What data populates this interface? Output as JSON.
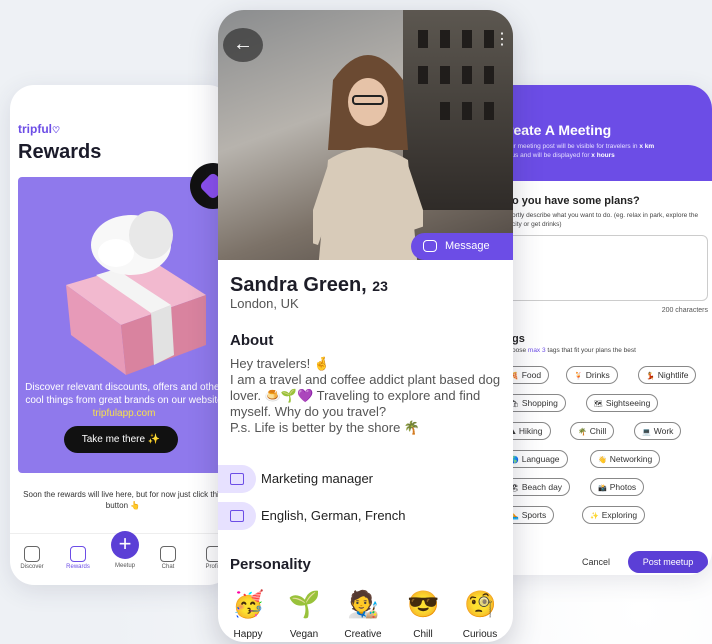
{
  "colors": {
    "accent": "#6c4de6",
    "dark": "#111111"
  },
  "rewards": {
    "brand": "tripful",
    "title": "Rewards",
    "description": "Discover relevant discounts, offers and other cool things  from great brands on our website ",
    "link": "tripfulapp.com",
    "cta": "Take me there ✨",
    "note": "Soon the rewards will live here, but for now just click this button 👆",
    "tabs": [
      {
        "label": "Discover",
        "icon": "compass-icon",
        "active": false
      },
      {
        "label": "Rewards",
        "icon": "gift-icon",
        "active": true
      },
      {
        "label": "Meetup",
        "icon": "plus-icon",
        "active": false
      },
      {
        "label": "Chat",
        "icon": "chat-icon",
        "active": false
      },
      {
        "label": "Profile",
        "icon": "profile-icon",
        "active": false
      }
    ]
  },
  "profile": {
    "message": "Message",
    "name": "Sandra Green,",
    "age": "23",
    "location": "London, UK",
    "about_heading": "About",
    "about_line1": "Hey travelers! 🤞",
    "about_line2": "I am a travel and coffee addict plant based dog lover. 🍮🌱💜 Traveling to explore and find myself. Why do you travel?",
    "about_line3": "P.s. Life is better by the shore 🌴",
    "job": "Marketing manager",
    "languages": "English, German, French",
    "personality_heading": "Personality",
    "personality": [
      {
        "label": "Happy",
        "emoji": "🥳"
      },
      {
        "label": "Vegan",
        "emoji": "🌱"
      },
      {
        "label": "Creative",
        "emoji": "🧑‍🎨"
      },
      {
        "label": "Chill",
        "emoji": "😎"
      },
      {
        "label": "Curious",
        "emoji": "🧐"
      }
    ]
  },
  "meeting": {
    "title": "reate A Meeting",
    "sub_a": "ur meeting post will be visible for travelers in ",
    "sub_km": "x km",
    "sub_b": "ius and will be displayed for ",
    "sub_hours": "x hours",
    "question": "o you have some plans?",
    "question_desc": "ortly describe what you want to do. (eg. relax in park, explore the city or get drinks)",
    "char_count": "200 characters",
    "tags_heading": "gs",
    "tags_desc_a": "oose ",
    "tags_desc_max": "max 3",
    "tags_desc_b": " tags that fit your plans the best",
    "tags": [
      {
        "label": "Food",
        "emoji": "🍕"
      },
      {
        "label": "Drinks",
        "emoji": "🍹"
      },
      {
        "label": "Nightlife",
        "emoji": "💃"
      },
      {
        "label": "Shopping",
        "emoji": "🛍"
      },
      {
        "label": "Sightseeing",
        "emoji": "🗺"
      },
      {
        "label": "Hiking",
        "emoji": "⛰"
      },
      {
        "label": "Chill",
        "emoji": "🌴"
      },
      {
        "label": "Work",
        "emoji": "💻"
      },
      {
        "label": "Language",
        "emoji": "🌎"
      },
      {
        "label": "Networking",
        "emoji": "👋"
      },
      {
        "label": "Beach day",
        "emoji": "🏖"
      },
      {
        "label": "Photos",
        "emoji": "📸"
      },
      {
        "label": "Sports",
        "emoji": "🏊"
      },
      {
        "label": "Exploring",
        "emoji": "✨"
      }
    ],
    "cancel": "Cancel",
    "post": "Post meetup"
  }
}
